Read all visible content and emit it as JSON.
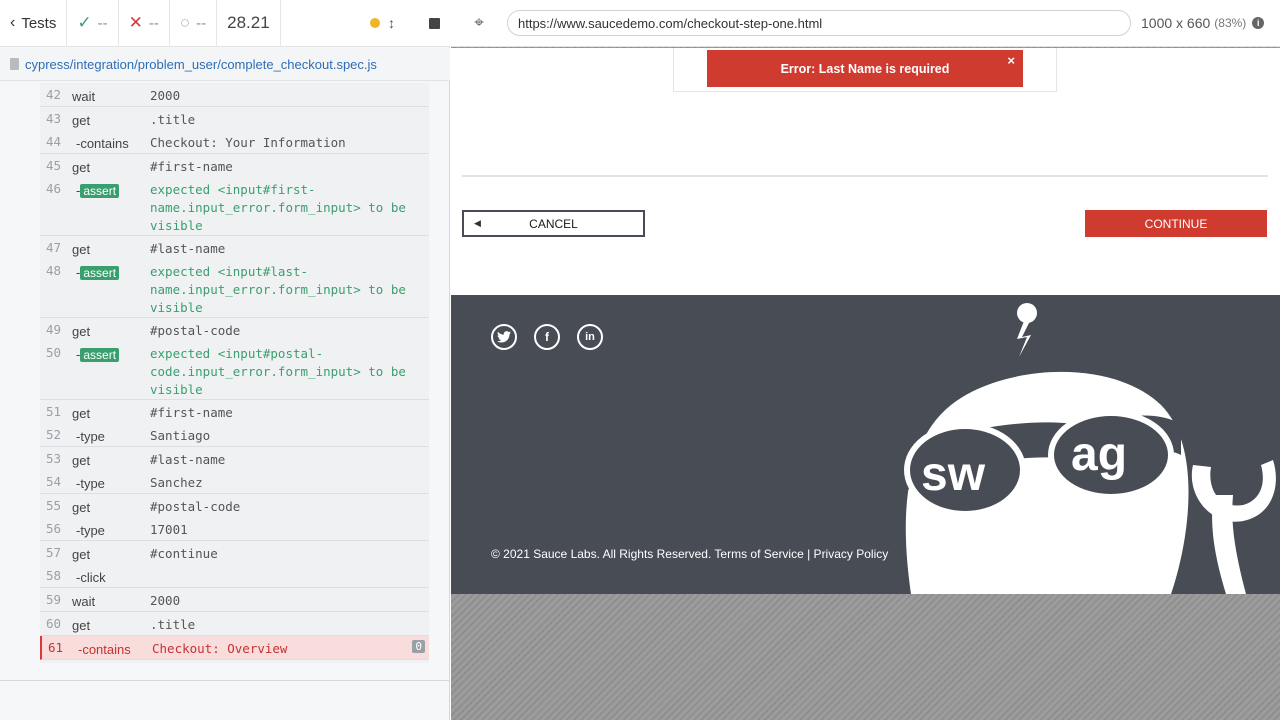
{
  "reporter": {
    "header": {
      "tests_label": "Tests",
      "passed": "--",
      "failed": "--",
      "pending": "--",
      "duration": "28.21"
    },
    "spec_path": "cypress/integration/problem_user/complete_checkout.spec.js",
    "commands": [
      {
        "num": "42",
        "cmd": "wait",
        "child": false,
        "msg": "2000"
      },
      {
        "num": "43",
        "cmd": "get",
        "child": false,
        "msg": ".title",
        "group_start": true,
        "sub": {
          "num": "44",
          "cmd": "-contains",
          "msg": "Checkout: Your Information"
        }
      },
      {
        "num": "45",
        "cmd": "get",
        "child": false,
        "msg": "#first-name",
        "sub": {
          "num": "46",
          "cmd": "-",
          "badge": "assert",
          "msg": "expected <input#first-name.input_error.form_input> to be visible"
        }
      },
      {
        "num": "47",
        "cmd": "get",
        "child": false,
        "msg": "#last-name",
        "sub": {
          "num": "48",
          "cmd": "-",
          "badge": "assert",
          "msg": "expected <input#last-name.input_error.form_input> to be visible"
        }
      },
      {
        "num": "49",
        "cmd": "get",
        "child": false,
        "msg": "#postal-code",
        "sub": {
          "num": "50",
          "cmd": "-",
          "badge": "assert",
          "msg": "expected <input#postal-code.input_error.form_input> to be visible"
        }
      },
      {
        "num": "51",
        "cmd": "get",
        "child": false,
        "msg": "#first-name",
        "sub": {
          "num": "52",
          "cmd": "-type",
          "msg": "Santiago"
        }
      },
      {
        "num": "53",
        "cmd": "get",
        "child": false,
        "msg": "#last-name",
        "sub": {
          "num": "54",
          "cmd": "-type",
          "msg": "Sanchez"
        }
      },
      {
        "num": "55",
        "cmd": "get",
        "child": false,
        "msg": "#postal-code",
        "sub": {
          "num": "56",
          "cmd": "-type",
          "msg": "17001"
        }
      },
      {
        "num": "57",
        "cmd": "get",
        "child": false,
        "msg": "#continue",
        "sub": {
          "num": "58",
          "cmd": "-click",
          "msg": ""
        }
      },
      {
        "num": "59",
        "cmd": "wait",
        "child": false,
        "msg": "2000"
      },
      {
        "num": "60",
        "cmd": "get",
        "child": false,
        "msg": ".title"
      }
    ],
    "failed_command": {
      "num": "61",
      "cmd": "-contains",
      "msg": "Checkout: Overview",
      "count": "0"
    }
  },
  "browser": {
    "url": "https://www.saucedemo.com/checkout-step-one.html",
    "viewport": "1000 x 660",
    "scale": "(83%)",
    "info_icon": "i"
  },
  "page": {
    "error_message": "Error: Last Name is required",
    "error_close": "×",
    "cancel_label": "CANCEL",
    "continue_label": "CONTINUE",
    "social": [
      "twitter-icon",
      "facebook-icon",
      "linkedin-icon"
    ],
    "footer_text": "© 2021 Sauce Labs. All Rights Reserved. Terms of Service | Privacy Policy",
    "mascot_text": [
      "sw",
      "ag"
    ]
  },
  "colors": {
    "accent_red": "#d03b2f",
    "footer_bg": "#474c55",
    "pass_green": "#3a9f6f"
  }
}
